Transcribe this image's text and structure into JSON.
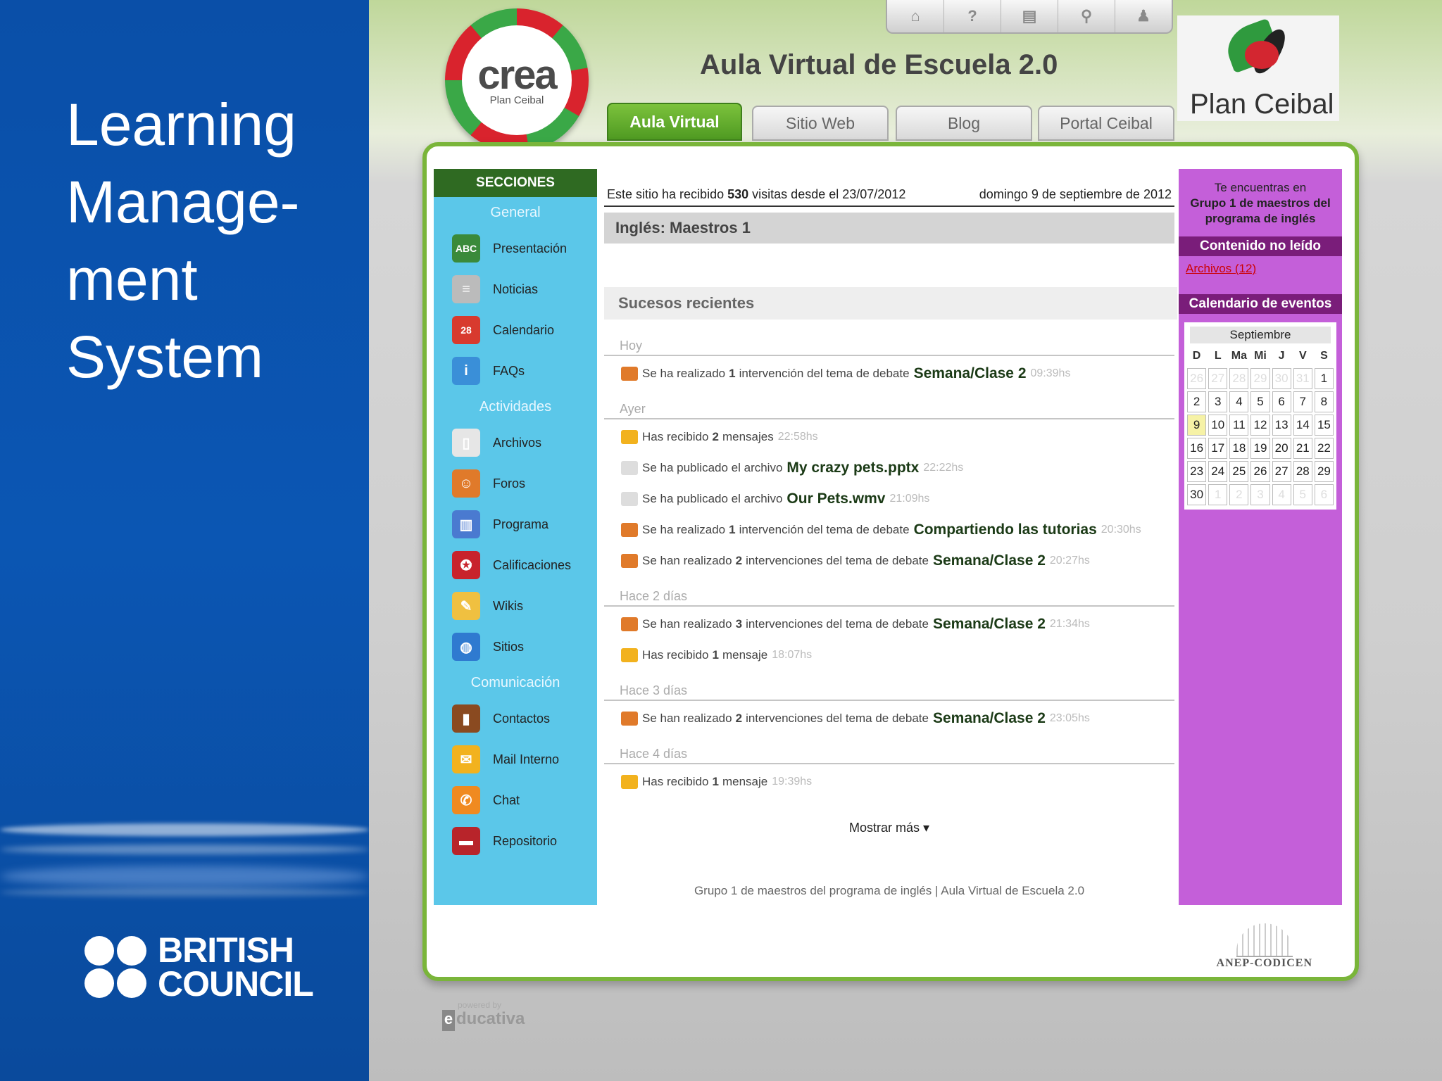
{
  "slide": {
    "title_lines": [
      "Learning",
      "Manage-",
      "ment",
      "System"
    ],
    "logo_text_1": "BRITISH",
    "logo_text_2": "COUNCIL"
  },
  "header": {
    "toolbar": [
      {
        "name": "home",
        "icon": "home-icon",
        "glyph": "⌂"
      },
      {
        "name": "help",
        "icon": "help-icon",
        "glyph": "?"
      },
      {
        "name": "briefcase",
        "icon": "briefcase-icon",
        "glyph": "▤"
      },
      {
        "name": "search",
        "icon": "search-icon",
        "glyph": "⚲"
      },
      {
        "name": "user",
        "icon": "user-icon",
        "glyph": "♟"
      }
    ],
    "crea_word": "crea",
    "crea_sub": "Plan Ceibal",
    "title": "Aula Virtual de Escuela 2.0",
    "ceibal_logo_text": "Plan Ceibal",
    "tabs": [
      "Aula Virtual",
      "Sitio Web",
      "Blog",
      "Portal Ceibal"
    ],
    "active_tab": "Aula Virtual"
  },
  "sidebar": {
    "title": "SECCIONES",
    "sections": [
      {
        "heading": "General",
        "items": [
          {
            "label": "Presentación",
            "icon": "abc-board-icon",
            "color": "#3a8a3a",
            "glyph": "ABC"
          },
          {
            "label": "Noticias",
            "icon": "newspaper-icon",
            "color": "#bbbbbb",
            "glyph": "≡"
          },
          {
            "label": "Calendario",
            "icon": "calendar-icon",
            "color": "#d83a2e",
            "glyph": "28"
          },
          {
            "label": "FAQs",
            "icon": "info-icon",
            "color": "#3a8fd8",
            "glyph": "i"
          }
        ]
      },
      {
        "heading": "Actividades",
        "items": [
          {
            "label": "Archivos",
            "icon": "file-icon",
            "color": "#e6e6e6",
            "glyph": "▯"
          },
          {
            "label": "Foros",
            "icon": "forum-icon",
            "color": "#e07a2a",
            "glyph": "☺"
          },
          {
            "label": "Programa",
            "icon": "books-icon",
            "color": "#4a7ad0",
            "glyph": "▥"
          },
          {
            "label": "Calificaciones",
            "icon": "ribbon-icon",
            "color": "#c8232c",
            "glyph": "✪"
          },
          {
            "label": "Wikis",
            "icon": "pencil-icon",
            "color": "#f0c040",
            "glyph": "✎"
          },
          {
            "label": "Sitios",
            "icon": "globe-icon",
            "color": "#2f7ad0",
            "glyph": "◍"
          }
        ]
      },
      {
        "heading": "Comunicación",
        "items": [
          {
            "label": "Contactos",
            "icon": "address-book-icon",
            "color": "#8a4a20",
            "glyph": "▮"
          },
          {
            "label": "Mail Interno",
            "icon": "envelope-icon",
            "color": "#f2b21e",
            "glyph": "✉"
          },
          {
            "label": "Chat",
            "icon": "chat-icon",
            "color": "#f08a20",
            "glyph": "✆"
          },
          {
            "label": "Repositorio",
            "icon": "toolbox-icon",
            "color": "#b8242a",
            "glyph": "▬"
          }
        ]
      }
    ]
  },
  "main": {
    "visits_prefix": "Este sitio ha recibido",
    "visits_count": "530",
    "visits_suffix": "visitas desde el 23/07/2012",
    "date": "domingo 9 de septiembre de 2012",
    "course_title": "Inglés: Maestros 1",
    "recent_heading": "Sucesos recientes",
    "days": [
      {
        "label": "Hoy",
        "events": [
          {
            "icon": "forum-icon",
            "color": "#e07a2a",
            "pre": "Se ha realizado",
            "bold": "1",
            "mid": "intervención del tema de debate",
            "link": "Semana/Clase 2",
            "time": "09:39hs"
          }
        ]
      },
      {
        "label": "Ayer",
        "events": [
          {
            "icon": "envelope-icon",
            "color": "#f2b21e",
            "pre": "Has recibido",
            "bold": "2",
            "mid": "mensajes",
            "link": "",
            "time": "22:58hs"
          },
          {
            "icon": "file-icon",
            "color": "#dddddd",
            "pre": "Se ha publicado el archivo",
            "bold": "",
            "mid": "",
            "link": "My crazy pets.pptx",
            "time": "22:22hs"
          },
          {
            "icon": "file-icon",
            "color": "#dddddd",
            "pre": "Se ha publicado el archivo",
            "bold": "",
            "mid": "",
            "link": "Our Pets.wmv",
            "time": "21:09hs"
          },
          {
            "icon": "forum-icon",
            "color": "#e07a2a",
            "pre": "Se ha realizado",
            "bold": "1",
            "mid": "intervención del tema de debate",
            "link": "Compartiendo las tutorias",
            "time": "20:30hs"
          },
          {
            "icon": "forum-icon",
            "color": "#e07a2a",
            "pre": "Se han realizado",
            "bold": "2",
            "mid": "intervenciones del tema de debate",
            "link": "Semana/Clase 2",
            "time": "20:27hs"
          }
        ]
      },
      {
        "label": "Hace 2 días",
        "events": [
          {
            "icon": "forum-icon",
            "color": "#e07a2a",
            "pre": "Se han realizado",
            "bold": "3",
            "mid": "intervenciones del tema de debate",
            "link": "Semana/Clase 2",
            "time": "21:34hs"
          },
          {
            "icon": "envelope-icon",
            "color": "#f2b21e",
            "pre": "Has recibido",
            "bold": "1",
            "mid": "mensaje",
            "link": "",
            "time": "18:07hs"
          }
        ]
      },
      {
        "label": "Hace 3 días",
        "events": [
          {
            "icon": "forum-icon",
            "color": "#e07a2a",
            "pre": "Se han realizado",
            "bold": "2",
            "mid": "intervenciones del tema de debate",
            "link": "Semana/Clase 2",
            "time": "23:05hs"
          }
        ]
      },
      {
        "label": "Hace 4 días",
        "events": [
          {
            "icon": "envelope-icon",
            "color": "#f2b21e",
            "pre": "Has recibido",
            "bold": "1",
            "mid": "mensaje",
            "link": "",
            "time": "19:39hs"
          }
        ]
      }
    ],
    "show_more": "Mostrar más ▾",
    "footer": "Grupo 1 de maestros del programa de inglés |  Aula Virtual de Escuela 2.0"
  },
  "rightbar": {
    "you_are_line1": "Te encuentras en",
    "you_are_group": "Grupo 1 de maestros del programa de inglés",
    "unread_heading": "Contenido no leído",
    "unread_link": "Archivos (12)",
    "calendar_heading": "Calendario de eventos",
    "month": "Septiembre",
    "weekdays": [
      "D",
      "L",
      "Ma",
      "Mi",
      "J",
      "V",
      "S"
    ],
    "cells": [
      "26",
      "27",
      "28",
      "29",
      "30",
      "31",
      "1",
      "2",
      "3",
      "4",
      "5",
      "6",
      "7",
      "8",
      "9",
      "10",
      "11",
      "12",
      "13",
      "14",
      "15",
      "16",
      "17",
      "18",
      "19",
      "20",
      "21",
      "22",
      "23",
      "24",
      "25",
      "26",
      "27",
      "28",
      "29",
      "30",
      "1",
      "2",
      "3",
      "4",
      "5",
      "6"
    ],
    "other_month_indices": [
      0,
      1,
      2,
      3,
      4,
      5,
      36,
      37,
      38,
      39,
      40,
      41
    ],
    "today_index": 14
  },
  "anep_text": "ANEP-CODICEN",
  "educativa": {
    "small": "powered by",
    "brand_e": "e",
    "brand": "ducativa"
  }
}
